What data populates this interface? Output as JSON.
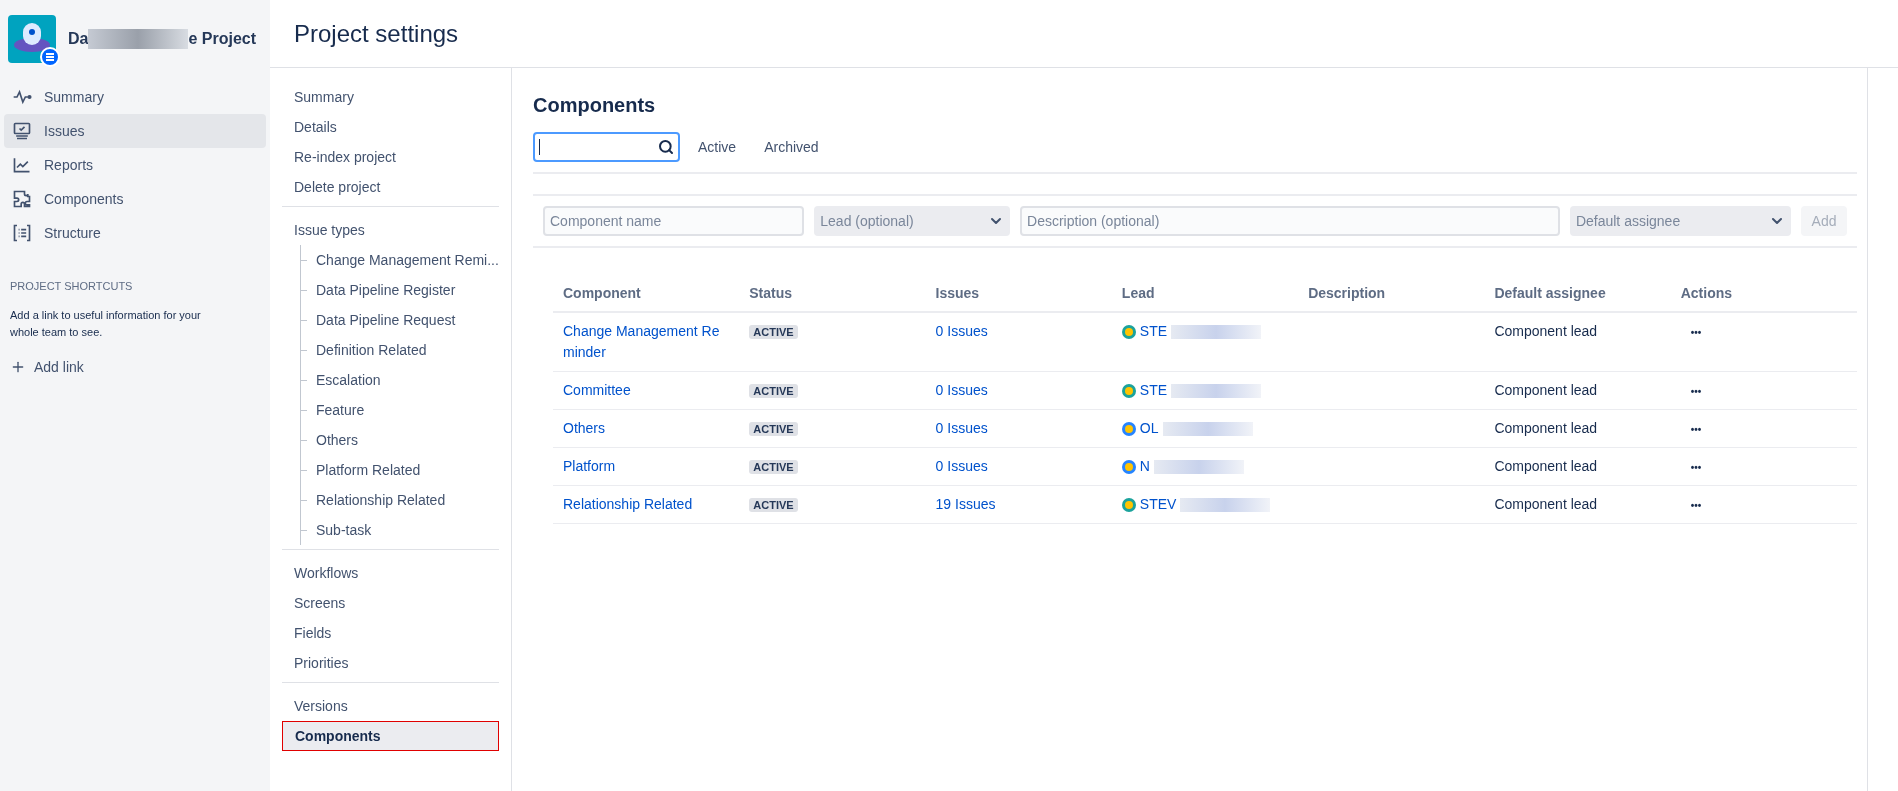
{
  "project": {
    "name_start": "Da",
    "name_end": "e Project"
  },
  "sidebar": {
    "items": [
      {
        "label": "Summary",
        "selected": false
      },
      {
        "label": "Issues",
        "selected": true
      },
      {
        "label": "Reports",
        "selected": false
      },
      {
        "label": "Components",
        "selected": false
      },
      {
        "label": "Structure",
        "selected": false
      }
    ],
    "shortcuts_heading": "PROJECT SHORTCUTS",
    "shortcuts_text": "Add a link to useful information for your whole team to see.",
    "add_link": "Add link"
  },
  "header": {
    "title": "Project settings"
  },
  "settings_nav": [
    {
      "items": [
        {
          "label": "Summary",
          "selected": false
        },
        {
          "label": "Details",
          "selected": false
        },
        {
          "label": "Re-index project",
          "selected": false
        },
        {
          "label": "Delete project",
          "selected": false
        }
      ]
    },
    {
      "items": [
        {
          "label": "Issue types",
          "selected": false,
          "children": [
            {
              "label": "Change Management Remi..."
            },
            {
              "label": "Data Pipeline Register"
            },
            {
              "label": "Data Pipeline Request"
            },
            {
              "label": "Definition Related"
            },
            {
              "label": "Escalation"
            },
            {
              "label": "Feature"
            },
            {
              "label": "Others"
            },
            {
              "label": "Platform Related"
            },
            {
              "label": "Relationship Related"
            },
            {
              "label": "Sub-task"
            }
          ]
        }
      ]
    },
    {
      "items": [
        {
          "label": "Workflows",
          "selected": false
        },
        {
          "label": "Screens",
          "selected": false
        },
        {
          "label": "Fields",
          "selected": false
        },
        {
          "label": "Priorities",
          "selected": false
        }
      ]
    },
    {
      "items": [
        {
          "label": "Versions",
          "selected": false
        },
        {
          "label": "Components",
          "selected": true
        }
      ]
    }
  ],
  "components": {
    "title": "Components",
    "filters": [
      {
        "label": "Active",
        "selected": false
      },
      {
        "label": "Archived",
        "selected": false
      }
    ],
    "form": {
      "name_placeholder": "Component name",
      "lead_placeholder": "Lead (optional)",
      "description_placeholder": "Description (optional)",
      "assignee_placeholder": "Default assignee",
      "add_button": "Add"
    },
    "table": {
      "columns": [
        "Component",
        "Status",
        "Issues",
        "Lead",
        "Description",
        "Default assignee",
        "Actions"
      ],
      "rows": [
        {
          "component": "Change Management Reminder",
          "status": "ACTIVE",
          "issues": "0 Issues",
          "lead": "STE",
          "color": "#1ba39c",
          "default_assignee": "Component lead",
          "actions": "•••"
        },
        {
          "component": "Committee",
          "status": "ACTIVE",
          "issues": "0 Issues",
          "lead": "STE",
          "color": "#1ba39c",
          "default_assignee": "Component lead",
          "actions": "•••"
        },
        {
          "component": "Others",
          "status": "ACTIVE",
          "issues": "0 Issues",
          "lead": "OL",
          "color": "#2684ff",
          "default_assignee": "Component lead",
          "actions": "•••"
        },
        {
          "component": "Platform",
          "status": "ACTIVE",
          "issues": "0 Issues",
          "lead": "N",
          "color": "#2684ff",
          "default_assignee": "Component lead",
          "actions": "•••"
        },
        {
          "component": "Relationship Related",
          "status": "ACTIVE",
          "issues": "19 Issues",
          "lead": "STEV",
          "color": "#1ba39c",
          "default_assignee": "Component lead",
          "actions": "•••"
        }
      ]
    }
  }
}
